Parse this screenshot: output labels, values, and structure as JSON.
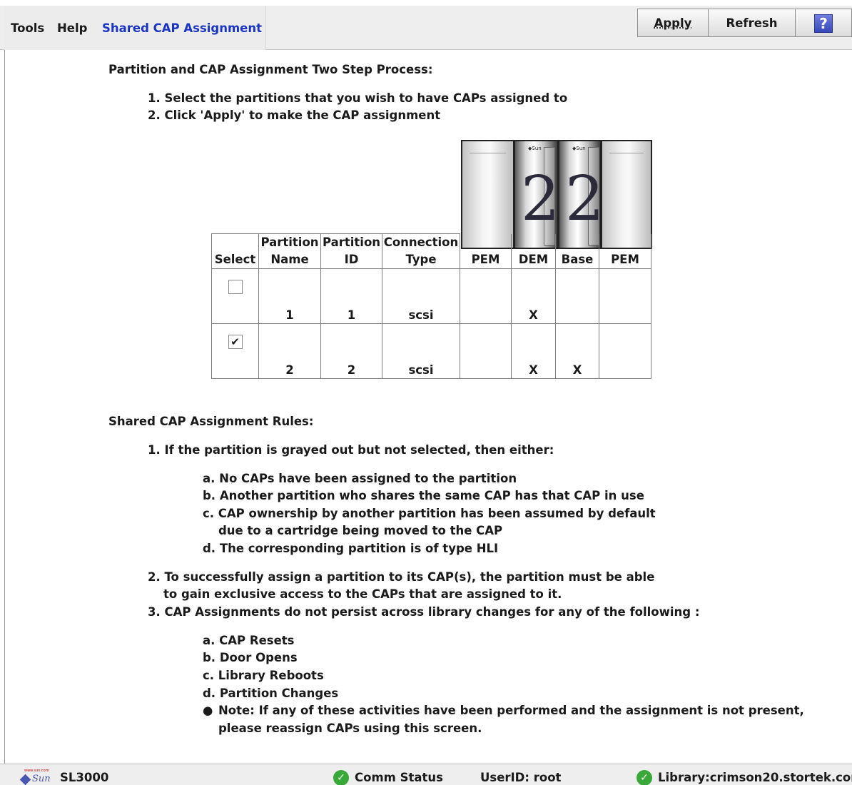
{
  "menu": {
    "tools": "Tools",
    "help": "Help",
    "title": "Shared CAP Assignment"
  },
  "toolbar": {
    "apply": "Apply",
    "refresh": "Refresh",
    "help_icon": "?"
  },
  "process": {
    "heading": "Partition and CAP Assignment Two Step Process:",
    "steps": [
      "1. Select the partitions that you wish to have CAPs assigned to",
      "2. Click 'Apply' to make the CAP assignment"
    ]
  },
  "library_images": [
    {
      "module": "PEM",
      "number": ""
    },
    {
      "module": "DEM",
      "number": "2"
    },
    {
      "module": "Base",
      "number": "2"
    },
    {
      "module": "PEM",
      "number": ""
    }
  ],
  "table": {
    "headers": {
      "select": "Select",
      "partition_name": [
        "Partition",
        "Name"
      ],
      "partition_id": [
        "Partition",
        "ID"
      ],
      "connection_type": [
        "Connection",
        "Type"
      ],
      "pem1": "PEM",
      "dem": "DEM",
      "base": "Base",
      "pem2": "PEM"
    },
    "rows": [
      {
        "checked": false,
        "check_mark": "",
        "name": "1",
        "id": "1",
        "type": "scsi",
        "pem1": "",
        "dem": "X",
        "base": "",
        "pem2": ""
      },
      {
        "checked": true,
        "check_mark": "✔",
        "name": "2",
        "id": "2",
        "type": "scsi",
        "pem1": "",
        "dem": "X",
        "base": "X",
        "pem2": ""
      }
    ]
  },
  "rules": {
    "heading": "Shared CAP Assignment Rules:",
    "rule1": "1. If the partition is grayed out but not selected, then either:",
    "rule1_items": [
      "a. No CAPs have been assigned to the partition",
      "b. Another partition who shares the same CAP has that CAP in use",
      "c. CAP ownership by another partition has been assumed by default",
      "due to a cartridge being moved to the CAP",
      "d. The corresponding partition is of type HLI"
    ],
    "rule2_line1": "2. To successfully assign a partition to its CAP(s), the partition must be able",
    "rule2_line2": "to gain exclusive access to the CAPs that are assigned to it.",
    "rule3": "3. CAP Assignments do not persist across library changes for any of the following :",
    "rule3_items": [
      "a. CAP Resets",
      "b. Door Opens",
      "c. Library Reboots",
      "d. Partition Changes"
    ],
    "note_line1": "Note: If any of these activities have been performed and the assignment is not present,",
    "note_line2": "please reassign CAPs using this screen."
  },
  "status": {
    "product": "SL3000",
    "logo_word": "Sun",
    "logo_tiny": "www.sun.com",
    "comm": "Comm Status",
    "user": "UserID: root",
    "library": "Library:crimson20.stortek.com"
  }
}
